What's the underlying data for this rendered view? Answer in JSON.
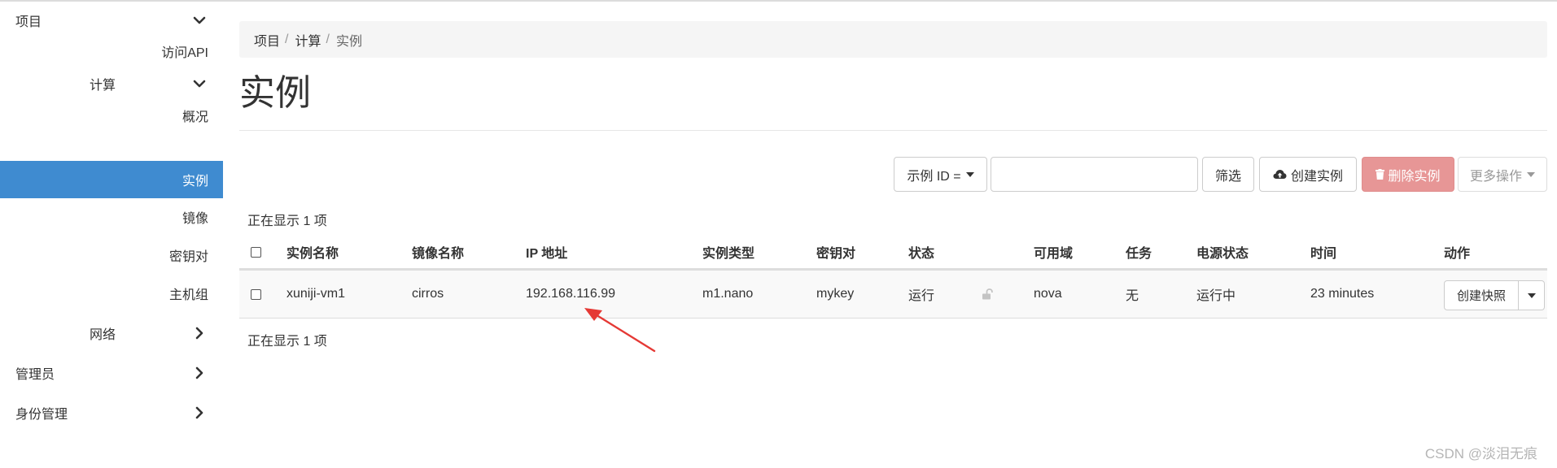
{
  "sidebar": {
    "project": "项目",
    "access_api": "访问API",
    "compute": "计算",
    "overview": "概况",
    "instances": "实例",
    "images": "镜像",
    "key_pairs": "密钥对",
    "host_groups": "主机组",
    "network": "网络",
    "admin": "管理员",
    "identity": "身份管理"
  },
  "breadcrumb": [
    "项目",
    "计算",
    "实例"
  ],
  "page_title": "实例",
  "toolbar": {
    "filter_field": "示例 ID =",
    "filter_value": "",
    "filter_button": "筛选",
    "create_button": "创建实例",
    "delete_button": "删除实例",
    "more_button": "更多操作"
  },
  "count_text": "正在显示 1 项",
  "table": {
    "headers": {
      "name": "实例名称",
      "image": "镜像名称",
      "ip": "IP 地址",
      "flavor": "实例类型",
      "keypair": "密钥对",
      "status": "状态",
      "az": "可用域",
      "task": "任务",
      "power": "电源状态",
      "time": "时间",
      "actions": "动作"
    },
    "rows": [
      {
        "name": "xuniji-vm1",
        "image": "cirros",
        "ip": "192.168.116.99",
        "flavor": "m1.nano",
        "keypair": "mykey",
        "status": "运行",
        "az": "nova",
        "task": "无",
        "power": "运行中",
        "time": "23 minutes",
        "action": "创建快照"
      }
    ]
  },
  "watermark": "CSDN @淡泪无痕",
  "colors": {
    "active_nav": "#3f8bd0",
    "link": "#337ab7",
    "delete_button": "#e79696",
    "annotation_arrow": "#e53935"
  },
  "icons": {
    "expanded": "chevron-down-icon",
    "collapsed": "chevron-right-icon",
    "create": "cloud-upload-icon",
    "delete": "trash-icon",
    "status_lock": "unlock-icon"
  }
}
